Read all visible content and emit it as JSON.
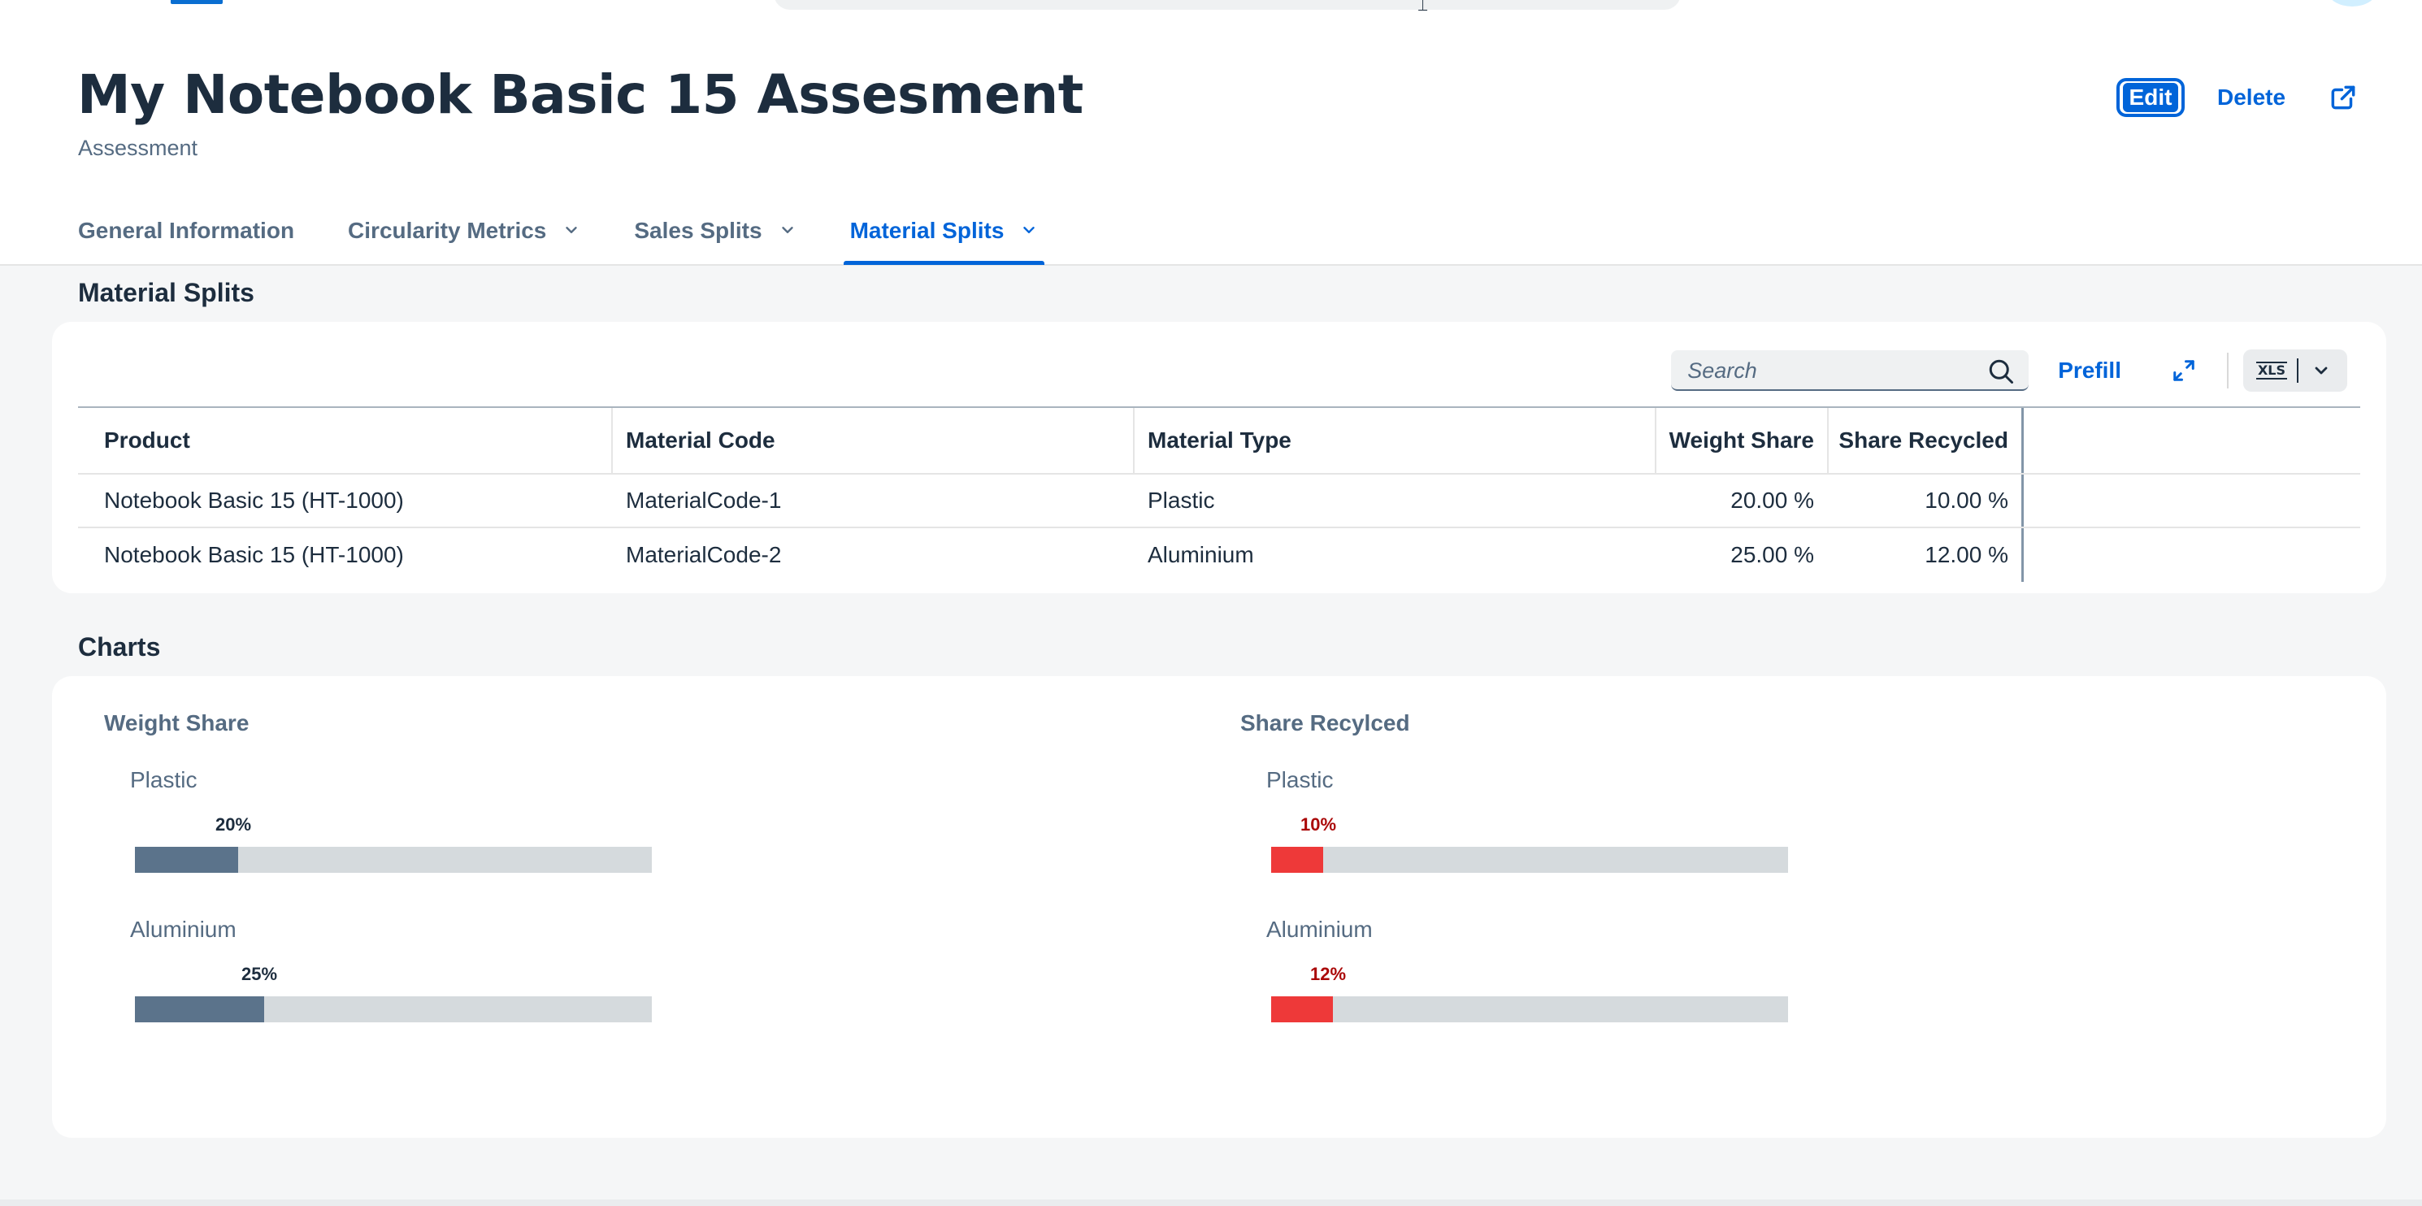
{
  "header": {
    "title": "My Notebook Basic 15 Assesment",
    "subtitle": "Assessment",
    "actions": {
      "edit": "Edit",
      "delete": "Delete",
      "share_icon": "share-icon"
    }
  },
  "tabs": [
    {
      "label": "General Information",
      "has_menu": false,
      "active": false
    },
    {
      "label": "Circularity Metrics",
      "has_menu": true,
      "active": false
    },
    {
      "label": "Sales Splits",
      "has_menu": true,
      "active": false
    },
    {
      "label": "Material Splits",
      "has_menu": true,
      "active": true
    }
  ],
  "material_splits": {
    "section_title": "Material Splits",
    "search": {
      "placeholder": "Search",
      "value": ""
    },
    "toolbar": {
      "prefill": "Prefill",
      "expand_icon": "fullscreen-icon",
      "export_icon": "xls-export-icon",
      "export_text": "XLS"
    },
    "table": {
      "columns": [
        "Product",
        "Material Code",
        "Material Type",
        "Weight Share",
        "Share Recycled"
      ],
      "rows": [
        [
          "Notebook Basic 15 (HT-1000)",
          "MaterialCode-1",
          "Plastic",
          "20.00 %",
          "10.00 %"
        ],
        [
          "Notebook Basic 15 (HT-1000)",
          "MaterialCode-2",
          "Aluminium",
          "25.00 %",
          "12.00 %"
        ]
      ]
    }
  },
  "charts_section": {
    "section_title": "Charts",
    "colors": {
      "weight_bar": "#5b738b",
      "recycled_bar": "#ee3939",
      "recycled_label": "#aa0808",
      "track": "#d5dadd"
    }
  },
  "chart_data": [
    {
      "type": "bar",
      "title": "Weight Share",
      "categories": [
        "Plastic",
        "Aluminium"
      ],
      "values": [
        20,
        25
      ],
      "value_labels": [
        "20%",
        "25%"
      ],
      "ylim": [
        0,
        100
      ]
    },
    {
      "type": "bar",
      "title": "Share Recylced",
      "categories": [
        "Plastic",
        "Aluminium"
      ],
      "values": [
        10,
        12
      ],
      "value_labels": [
        "10%",
        "12%"
      ],
      "ylim": [
        0,
        100
      ]
    }
  ]
}
